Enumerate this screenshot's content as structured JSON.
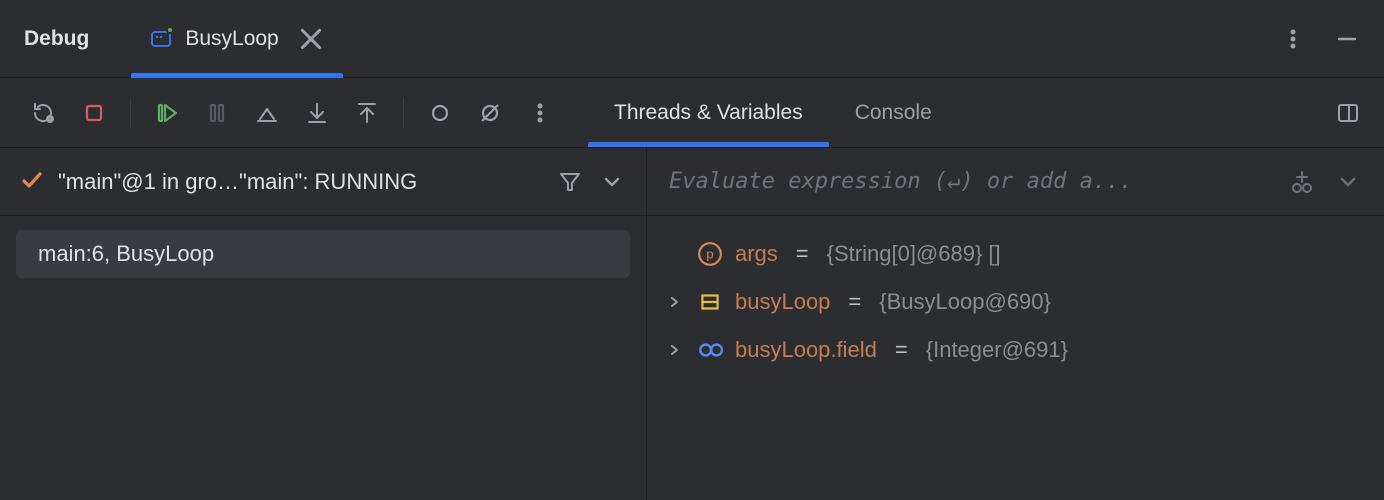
{
  "window": {
    "title": "Debug"
  },
  "tabs": [
    {
      "label": "BusyLoop",
      "active": true
    }
  ],
  "toolbar": {
    "view_tabs": [
      {
        "label": "Threads & Variables",
        "active": true
      },
      {
        "label": "Console",
        "active": false
      }
    ]
  },
  "threads_panel": {
    "current_thread": "\"main\"@1 in gro…\"main\": RUNNING",
    "frames": [
      {
        "label": "main:6, BusyLoop"
      }
    ]
  },
  "variables_panel": {
    "evaluate_placeholder": "Evaluate expression (↵) or add a...",
    "vars": [
      {
        "icon": "param",
        "name": "args",
        "value": "{String[0]@689} []",
        "expandable": false
      },
      {
        "icon": "object",
        "name": "busyLoop",
        "value": "{BusyLoop@690}",
        "expandable": true
      },
      {
        "icon": "watch",
        "name": "busyLoop.field",
        "value": "{Integer@691}",
        "expandable": true
      }
    ]
  }
}
